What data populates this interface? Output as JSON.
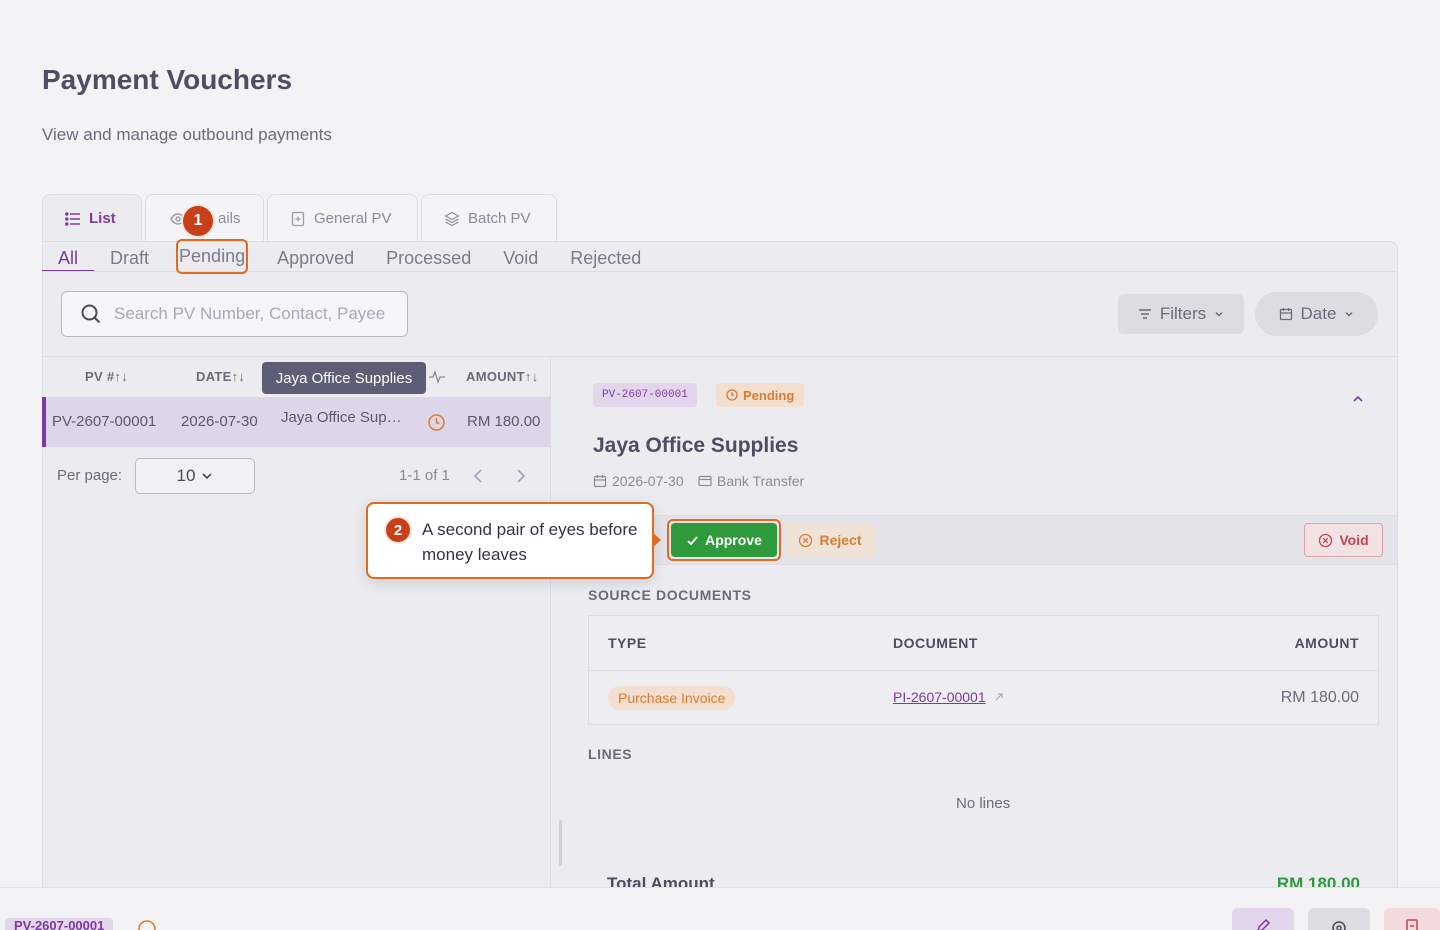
{
  "header": {
    "title": "Payment Vouchers",
    "subtitle": "View and manage outbound payments"
  },
  "view_tabs": [
    {
      "label": "List",
      "icon": "list-icon"
    },
    {
      "label": "ails",
      "icon": "eye-icon"
    },
    {
      "label": "General PV",
      "icon": "file-plus-icon"
    },
    {
      "label": "Batch PV",
      "icon": "layers-icon"
    }
  ],
  "status_tabs": [
    "All",
    "Draft",
    "Pending",
    "Approved",
    "Processed",
    "Void",
    "Rejected"
  ],
  "search": {
    "placeholder": "Search PV Number, Contact, Payee"
  },
  "toolbar": {
    "filters_label": "Filters",
    "date_label": "Date"
  },
  "list": {
    "columns": [
      "PV #",
      "DATE",
      "AMOUNT"
    ],
    "tooltip": "Jaya Office Supplies",
    "rows": [
      {
        "pv": "PV-2607-00001",
        "date": "2026-07-30",
        "contact": "Jaya Office Sup…",
        "amount": "RM 180.00",
        "status_icon": "clock-icon"
      }
    ],
    "per_page_label": "Per page:",
    "per_page_value": "10",
    "pager_text": "1-1 of 1"
  },
  "detail": {
    "pv_number": "PV-2607-00001",
    "status": "Pending",
    "vendor": "Jaya Office Supplies",
    "date": "2026-07-30",
    "payment_method": "Bank Transfer",
    "actions": {
      "approve": "Approve",
      "reject": "Reject",
      "void": "Void"
    },
    "source_documents": {
      "title": "SOURCE DOCUMENTS",
      "columns": [
        "TYPE",
        "DOCUMENT",
        "AMOUNT"
      ],
      "rows": [
        {
          "type": "Purchase Invoice",
          "document": "PI-2607-00001",
          "amount": "RM 180.00"
        }
      ]
    },
    "lines_title": "LINES",
    "no_lines": "No lines",
    "total_label": "Total Amount",
    "total_value": "RM 180.00"
  },
  "bottom_bar": {
    "pv_number": "PV-2607-00001"
  },
  "callouts": [
    {
      "number": "1"
    },
    {
      "number": "2",
      "text": "A second pair of eyes before money leaves"
    }
  ],
  "colors": {
    "accent": "#7d3aa0",
    "approve": "#2e9a3c",
    "pending": "#d97b2e",
    "void": "#c24450",
    "callout": "#e06a1f"
  }
}
